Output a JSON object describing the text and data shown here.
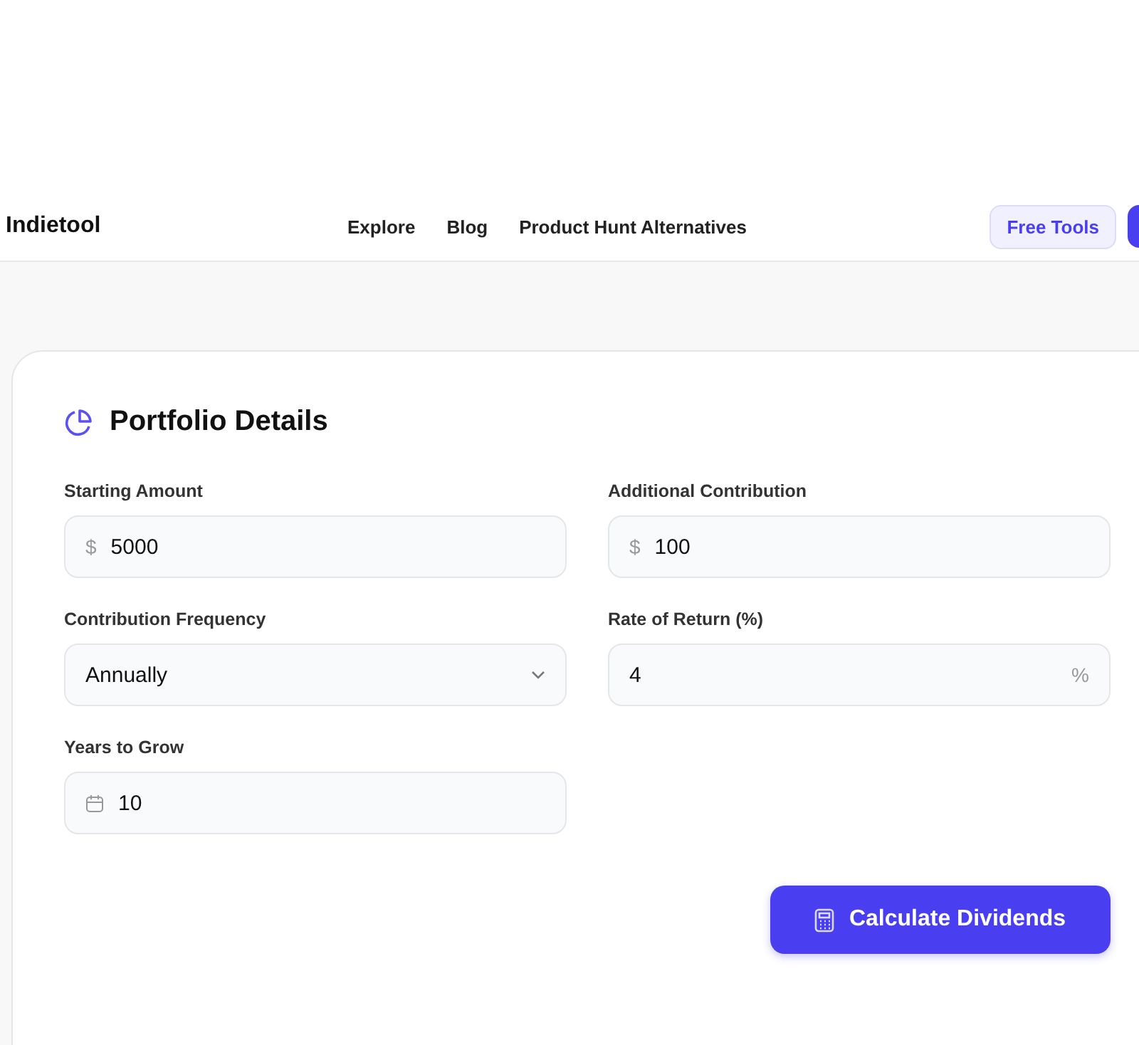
{
  "header": {
    "brand": "Indietool",
    "nav": [
      "Explore",
      "Blog",
      "Product Hunt Alternatives"
    ],
    "free_tools": "Free Tools"
  },
  "card": {
    "title": "Portfolio Details",
    "fields": [
      {
        "kind": "prefix",
        "label": "Starting Amount",
        "prefix": "$",
        "value": "5000"
      },
      {
        "kind": "prefix",
        "label": "Additional Contribution",
        "prefix": "$",
        "value": "100"
      },
      {
        "kind": "select",
        "label": "Contribution Frequency",
        "value": "Annually"
      },
      {
        "kind": "suffix",
        "label": "Rate of Return (%)",
        "suffix": "%",
        "value": "4"
      },
      {
        "kind": "date",
        "label": "Years to Grow",
        "value": "10"
      }
    ],
    "button": "Calculate Dividends"
  }
}
